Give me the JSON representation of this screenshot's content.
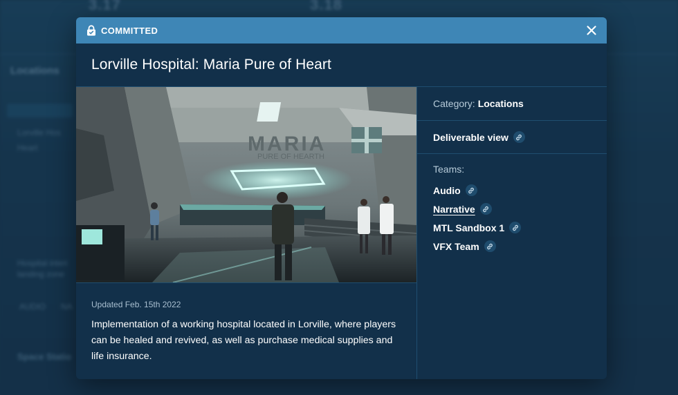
{
  "background": {
    "column_titles": [
      "3.17",
      "3.18"
    ],
    "sidebar_heading": "Locations",
    "sidebar_snippets": [
      "Lorville Hos",
      "Heart",
      "Hospital interi",
      "landing zone",
      "Space Statio"
    ],
    "footer_tabs": [
      "AUDIO",
      "NA"
    ]
  },
  "modal": {
    "status_label": "COMMITTED",
    "title": "Lorville Hospital: Maria Pure of Heart",
    "image_alt": "Concept art of the Maria Pure of Heart hospital lobby in Lorville",
    "image_sign": {
      "line1": "MARIA",
      "line2": "PURE OF HEARTH"
    },
    "updated": "Updated Feb. 15th 2022",
    "description": "Implementation of a working hospital located in Lorville, where players can be healed and revived, as well as purchase medical supplies and life insurance.",
    "category": {
      "label": "Category:",
      "value": "Locations"
    },
    "deliverable_view": "Deliverable view",
    "teams_label": "Teams:",
    "teams": [
      {
        "name": "Audio"
      },
      {
        "name": "Narrative"
      },
      {
        "name": "MTL Sandbox 1"
      },
      {
        "name": "VFX Team"
      }
    ]
  },
  "colors": {
    "header": "#3e86b6",
    "modal_bg": "#12304a",
    "divider": "#1f4e70",
    "link_chip": "#1f4c6d"
  },
  "icons": [
    "lock-icon",
    "close-icon",
    "link-icon"
  ]
}
